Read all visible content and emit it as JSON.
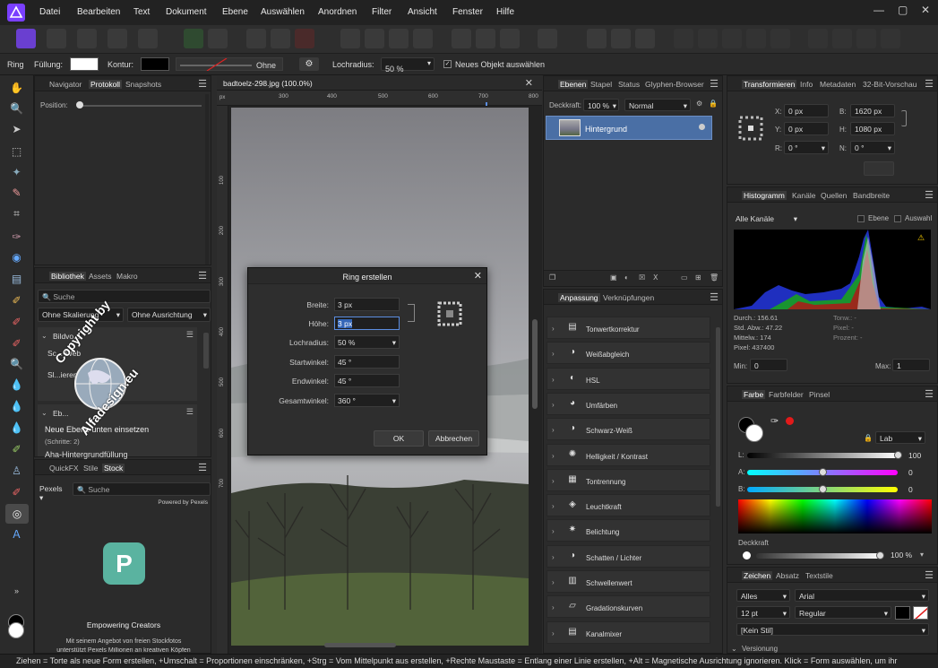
{
  "menubar": {
    "items": [
      "Datei",
      "Bearbeiten",
      "Text",
      "Dokument",
      "Ebene",
      "Auswählen",
      "Anordnen",
      "Filter",
      "Ansicht",
      "Fenster",
      "Hilfe"
    ],
    "minimize": "—",
    "maximize": "▢",
    "close": "✕"
  },
  "context": {
    "tool_name": "Ring",
    "fill_label": "Füllung:",
    "stroke_label": "Kontur:",
    "stroke_none": "Ohne",
    "hole_radius_label": "Lochradius:",
    "hole_radius_value": "50 %",
    "select_new_object": "Neues Objekt auswählen",
    "fill_color": "#ffffff",
    "stroke_color": "#000000"
  },
  "left_top_panel": {
    "tabs": [
      "Navigator",
      "Protokoll",
      "Snapshots"
    ],
    "position_label": "Position:"
  },
  "library_panel": {
    "tabs": [
      "Bibliothek",
      "Assets",
      "Makro"
    ],
    "search_placeholder": "Suche",
    "scale_option": "Ohne Skalierung",
    "align_option": "Ohne Ausrichtung",
    "group1": "Bildvo...",
    "item_a": "Sc...-Web",
    "item_b": "Sl...ieren",
    "group2": "Eb...",
    "item_c": "Neue Ebene unten einsetzen",
    "item_c_steps": "(Schritte: 2)",
    "item_d": "Aha-Hintergrundfüllung"
  },
  "stock_panel": {
    "tabs": [
      "QuickFX",
      "Stile",
      "Stock"
    ],
    "provider": "Pexels",
    "search_placeholder": "Suche",
    "powered": "Powered by Pexels",
    "logo_letter": "P",
    "tagline": "Empowering Creators",
    "desc1": "Mit seinem Angebot von freien Stockfotos",
    "desc2": "unterstützt Pexels Millionen an kreativen Köpfen"
  },
  "document": {
    "tab_title": "badtoelz-298.jpg (100.0%)",
    "ruler_unit": "px",
    "h_ticks": [
      "300",
      "400",
      "500",
      "600",
      "700",
      "800"
    ],
    "v_ticks": [
      "100",
      "200",
      "300",
      "400",
      "500",
      "600",
      "700"
    ]
  },
  "watermark": {
    "line1": "Copyright by",
    "line2": "Alfadesign.eu"
  },
  "dialog": {
    "title": "Ring erstellen",
    "fields": [
      {
        "label": "Breite:",
        "value": "3 px"
      },
      {
        "label": "Höhe:",
        "value": "3 px"
      },
      {
        "label": "Lochradius:",
        "value": "50 %"
      },
      {
        "label": "Startwinkel:",
        "value": "45 °"
      },
      {
        "label": "Endwinkel:",
        "value": "45 °"
      },
      {
        "label": "Gesamtwinkel:",
        "value": "360 °"
      }
    ],
    "ok": "OK",
    "cancel": "Abbrechen"
  },
  "layers_panel": {
    "tabs": [
      "Ebenen",
      "Stapel",
      "Status",
      "Glyphen-Browser"
    ],
    "opacity_label": "Deckkraft:",
    "opacity_value": "100 %",
    "blend_mode": "Normal",
    "layer_name": "Hintergrund"
  },
  "adjust_panel": {
    "tabs": [
      "Anpassung",
      "Verknüpfungen"
    ],
    "items": [
      "Tonwertkorrektur",
      "Weißabgleich",
      "HSL",
      "Umfärben",
      "Schwarz-Weiß",
      "Helligkeit / Kontrast",
      "Tontrennung",
      "Leuchtkraft",
      "Belichtung",
      "Schatten / Lichter",
      "Schwellenwert",
      "Gradationskurven",
      "Kanalmixer"
    ]
  },
  "transform_panel": {
    "tabs": [
      "Transformieren",
      "Info",
      "Metadaten",
      "32-Bit-Vorschau"
    ],
    "x_label": "X:",
    "x_value": "0 px",
    "y_label": "Y:",
    "y_value": "0 px",
    "b_label": "B:",
    "b_value": "1620 px",
    "h_label": "H:",
    "h_value": "1080 px",
    "r_label": "R:",
    "r_value": "0 °",
    "n_label": "N:",
    "n_value": "0 °"
  },
  "histogram_panel": {
    "tabs": [
      "Histogramm",
      "Kanäle",
      "Quellen",
      "Bandbreite"
    ],
    "channel": "Alle Kanäle",
    "layer_check": "Ebene",
    "selection_check": "Auswahl",
    "stats_left": [
      "Durch.: 156.61",
      "Std. Abw.: 47.22",
      "Mittelw.: 174",
      "Pixel: 437400"
    ],
    "stats_right": [
      "Tonw.: -",
      "Pixel: -",
      "Prozent: -"
    ],
    "min_label": "Min:",
    "min_value": "0",
    "max_label": "Max:",
    "max_value": "1"
  },
  "color_panel": {
    "tabs": [
      "Farbe",
      "Farbfelder",
      "Pinsel"
    ],
    "mode": "Lab",
    "l_label": "L:",
    "l_value": "100",
    "l_fraction": 1.0,
    "a_label": "A:",
    "a_value": "0",
    "a_fraction": 0.5,
    "b_label": "B:",
    "b_value": "0",
    "b_fraction": 0.5,
    "opacity_label": "Deckkraft",
    "opacity_value": "100 %"
  },
  "char_panel": {
    "tabs": [
      "Zeichen",
      "Absatz",
      "Textstile"
    ],
    "scope": "Alles",
    "font": "Arial",
    "size": "12 pt",
    "style": "Regular",
    "char_style": "[Kein Stil]",
    "section": "Versionung"
  },
  "status": {
    "text": "Ziehen = Torte als neue Form erstellen, +Umschalt = Proportionen einschränken, +Strg = Vom Mittelpunkt aus erstellen, +Rechte Maustaste = Entlang einer Linie erstellen, +Alt = Magnetische Ausrichtung ignorieren. Klick = Form auswählen, um ihr"
  },
  "colors": {
    "accent": "#4a6fa5",
    "affinity_purple": "#8a4fff",
    "pexels_teal": "#5ab3a0"
  }
}
